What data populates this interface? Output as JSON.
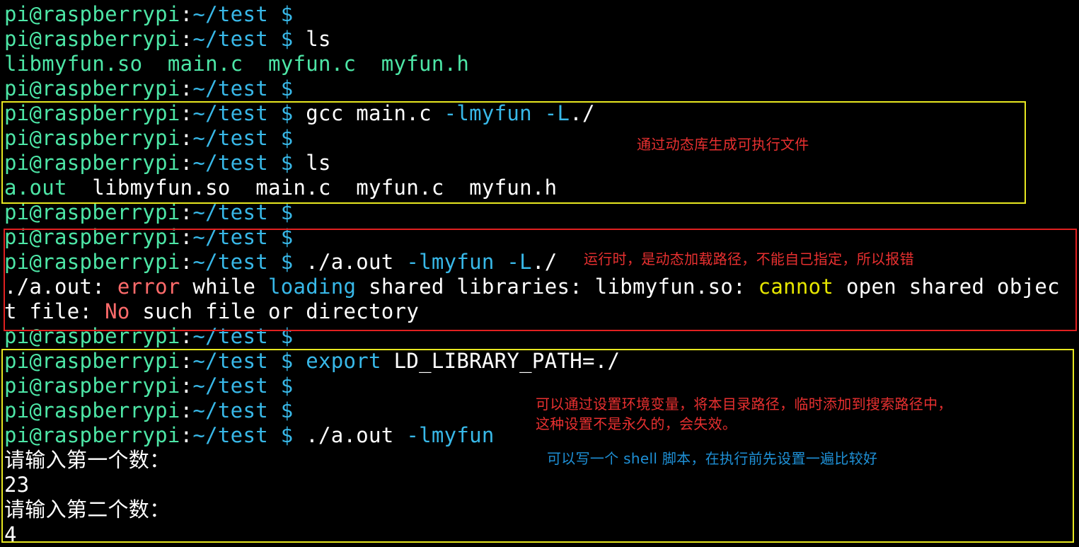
{
  "prompt": {
    "user_host": "pi@raspberrypi",
    "sep": ":",
    "path": "~/test $"
  },
  "lines": [
    {
      "cmd": ""
    },
    {
      "cmd": " ls"
    },
    {
      "output": "libmyfun.so  main.c  myfun.c  myfun.h"
    },
    {
      "cmd": ""
    },
    {
      "cmd": " gcc main.c ",
      "flag": "-lmyfun -L",
      "rest": "./"
    },
    {
      "cmd": ""
    },
    {
      "cmd": " ls"
    },
    {
      "output_colored": "a.out",
      "output_rest": "  libmyfun.so  main.c  myfun.c  myfun.h"
    },
    {
      "cmd": ""
    },
    {
      "cmd": ""
    },
    {
      "cmd": " ./a.out ",
      "flag": "-lmyfun -L",
      "rest": "./"
    },
    {
      "err1a": "./a.out: ",
      "err1b": "error",
      "err1c": " while ",
      "err1d": "loading",
      "err1e": " shared libraries: libmyfun.so: ",
      "err1f": "cannot",
      "err1g": " open shared objec"
    },
    {
      "err2a": "t file: ",
      "err2b": "No",
      "err2c": " such file or directory"
    },
    {
      "cmd": ""
    },
    {
      "cmd_kw": " export",
      "cmd": " LD_LIBRARY_PATH=./"
    },
    {
      "cmd": ""
    },
    {
      "cmd": ""
    },
    {
      "cmd": " ./a.out ",
      "flag": "-lmyfun"
    },
    {
      "output": "请输入第一个数："
    },
    {
      "output": "23"
    },
    {
      "output": "请输入第二个数："
    },
    {
      "output": "4"
    }
  ],
  "annotations": {
    "note1": "通过动态库生成可执行文件",
    "note2": "运行时，是动态加载路径，不能自己指定，所以报错",
    "note3_line1": "可以通过设置环境变量，将本目录路径，临时添加到搜索路径中，",
    "note3_line2": "这种设置不是永久的，会失效。",
    "note4": "可以写一个 shell 脚本，在执行前先设置一遍比较好"
  },
  "colors": {
    "background": "#000000",
    "prompt_user": "#4de6a6",
    "prompt_path": "#38b8e8",
    "error": "#ff6b6b",
    "warning": "#e6e600",
    "box_yellow": "#e8e820",
    "box_red": "#e02020",
    "note_red": "#e83030",
    "note_blue": "#1e90d6"
  }
}
